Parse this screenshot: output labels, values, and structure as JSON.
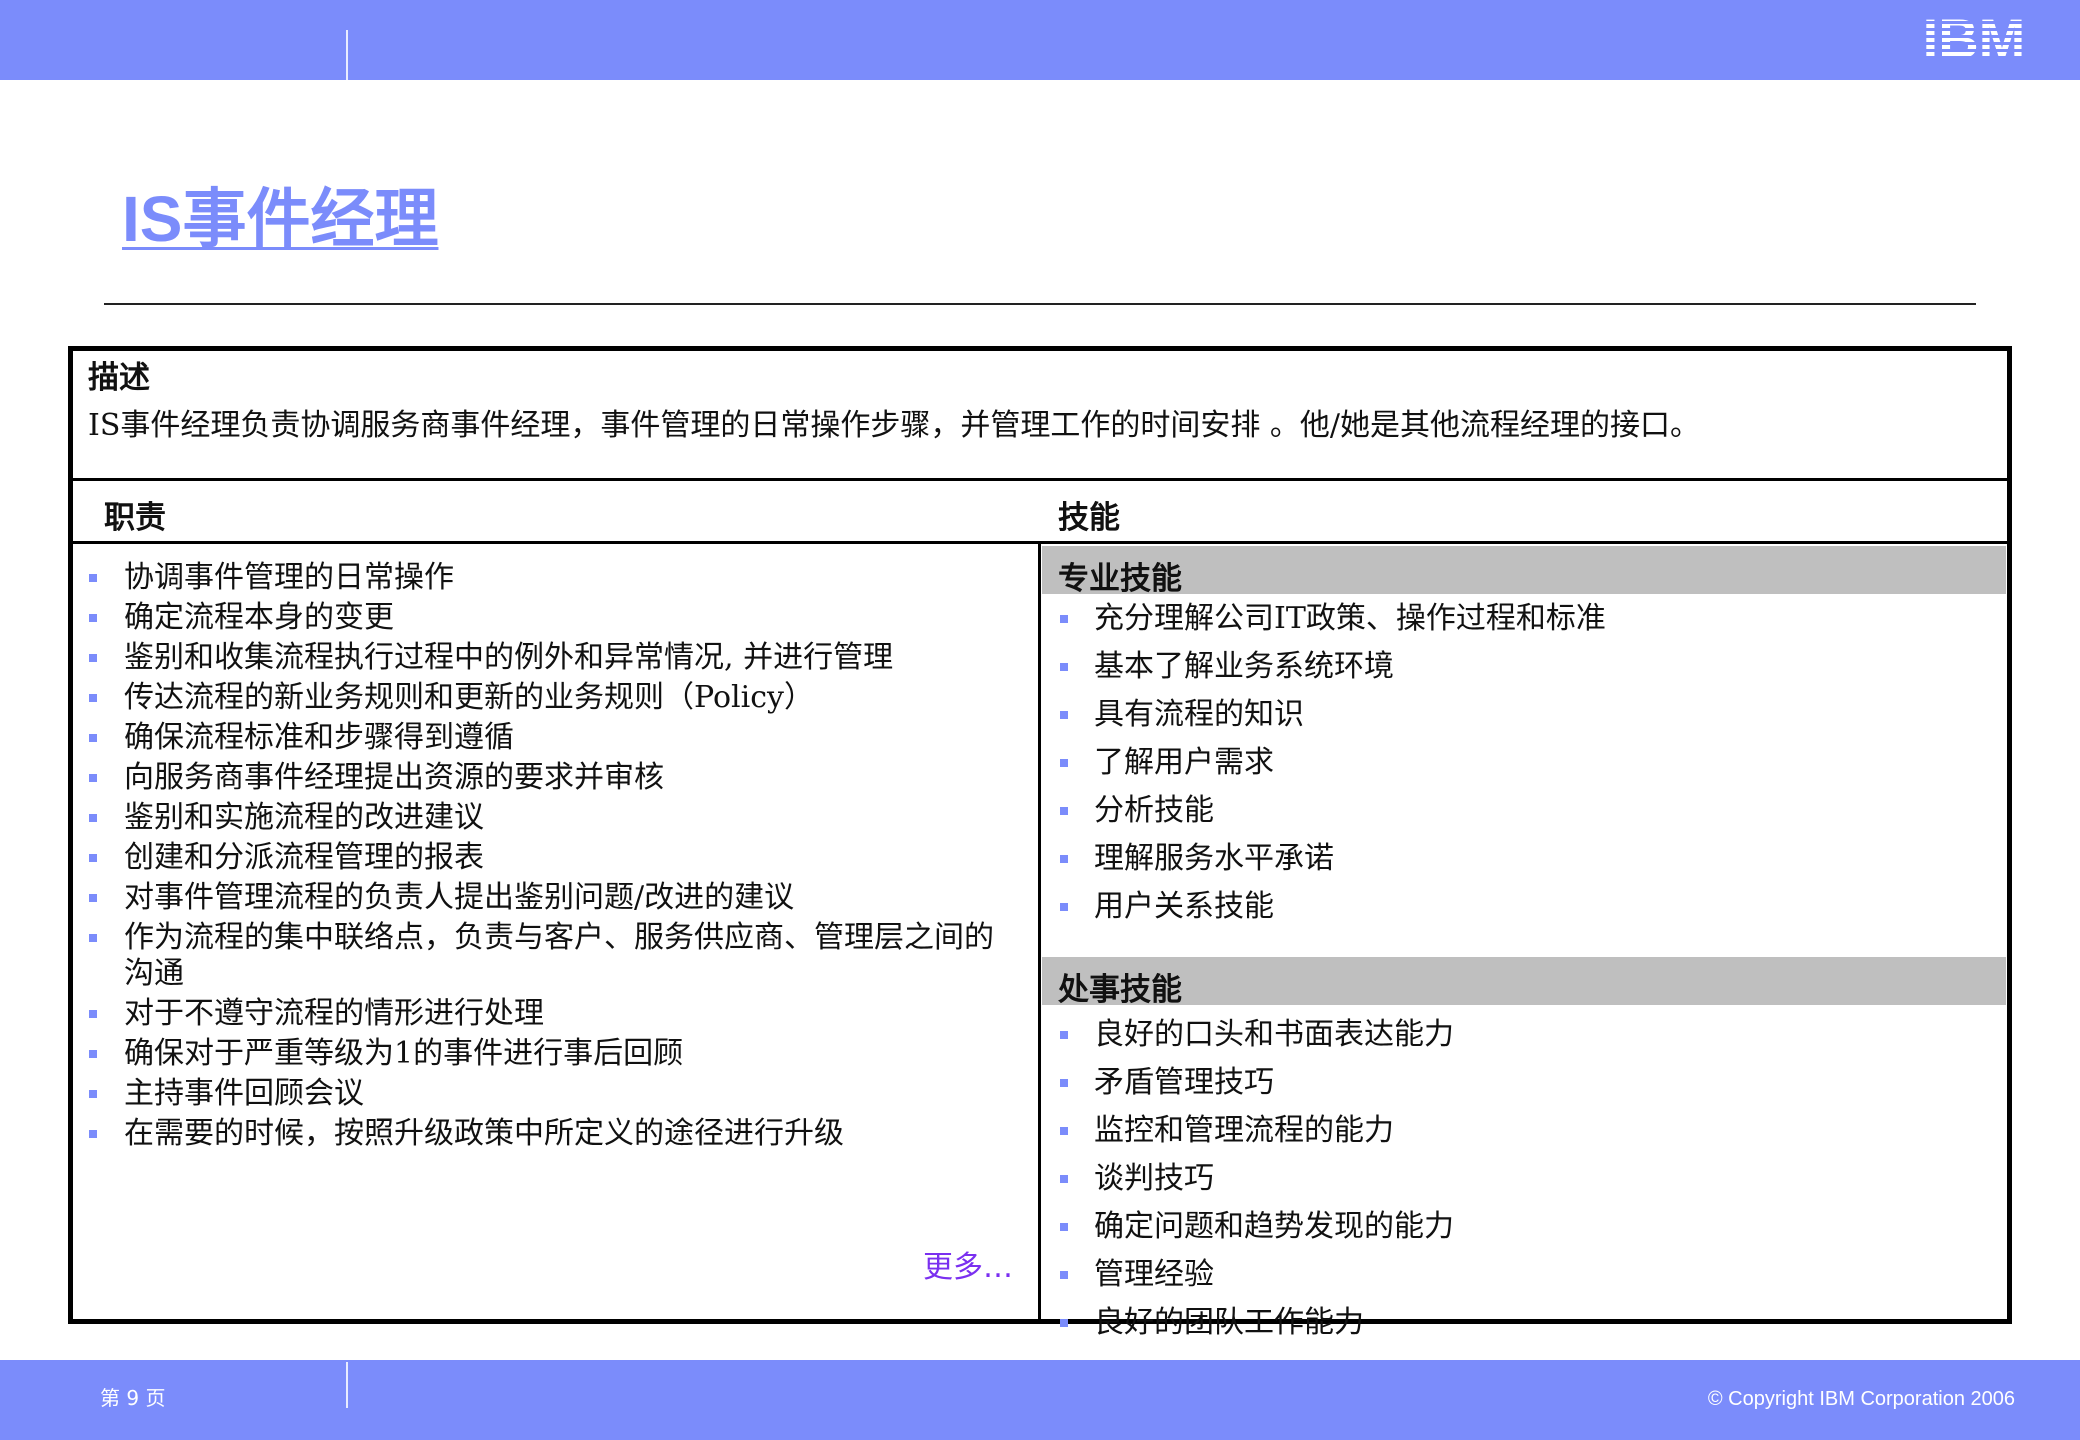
{
  "header": {
    "logo_text": "IBM"
  },
  "title": "IS事件经理",
  "description": {
    "label": "描述",
    "text": "IS事件经理负责协调服务商事件经理，事件管理的日常操作步骤，并管理工作的时间安排 。他/她是其他流程经理的接口。"
  },
  "responsibilities": {
    "heading": "职责",
    "items": [
      "协调事件管理的日常操作",
      "确定流程本身的变更",
      "鉴别和收集流程执行过程中的例外和异常情况, 并进行管理",
      "传达流程的新业务规则和更新的业务规则（Policy）",
      "确保流程标准和步骤得到遵循",
      "向服务商事件经理提出资源的要求并审核",
      "鉴别和实施流程的改进建议",
      "创建和分派流程管理的报表",
      "对事件管理流程的负责人提出鉴别问题/改进的建议",
      "作为流程的集中联络点，负责与客户、服务供应商、管理层之间的沟通",
      "对于不遵守流程的情形进行处理",
      "确保对于严重等级为1的事件进行事后回顾",
      "主持事件回顾会议",
      "在需要的时候，按照升级政策中所定义的途径进行升级"
    ],
    "more_link": "更多…"
  },
  "skills": {
    "heading": "技能",
    "professional": {
      "label": "专业技能",
      "items": [
        "充分理解公司IT政策、操作过程和标准",
        "基本了解业务系统环境",
        "具有流程的知识",
        "了解用户需求",
        "分析技能",
        "理解服务水平承诺",
        "用户关系技能"
      ]
    },
    "interpersonal": {
      "label": "处事技能",
      "items": [
        "良好的口头和书面表达能力",
        "矛盾管理技巧",
        "监控和管理流程的能力",
        "谈判技巧",
        "确定问题和趋势发现的能力",
        "管理经验",
        "良好的团队工作能力"
      ]
    }
  },
  "footer": {
    "page_label": "第 9 页",
    "copyright": "© Copyright IBM Corporation 2006"
  },
  "colors": {
    "bar": "#7b8cfb",
    "title": "#7b8cfb",
    "bullet": "#7b8cfb",
    "link": "#7a2ff0",
    "band": "#bfbfbf"
  }
}
